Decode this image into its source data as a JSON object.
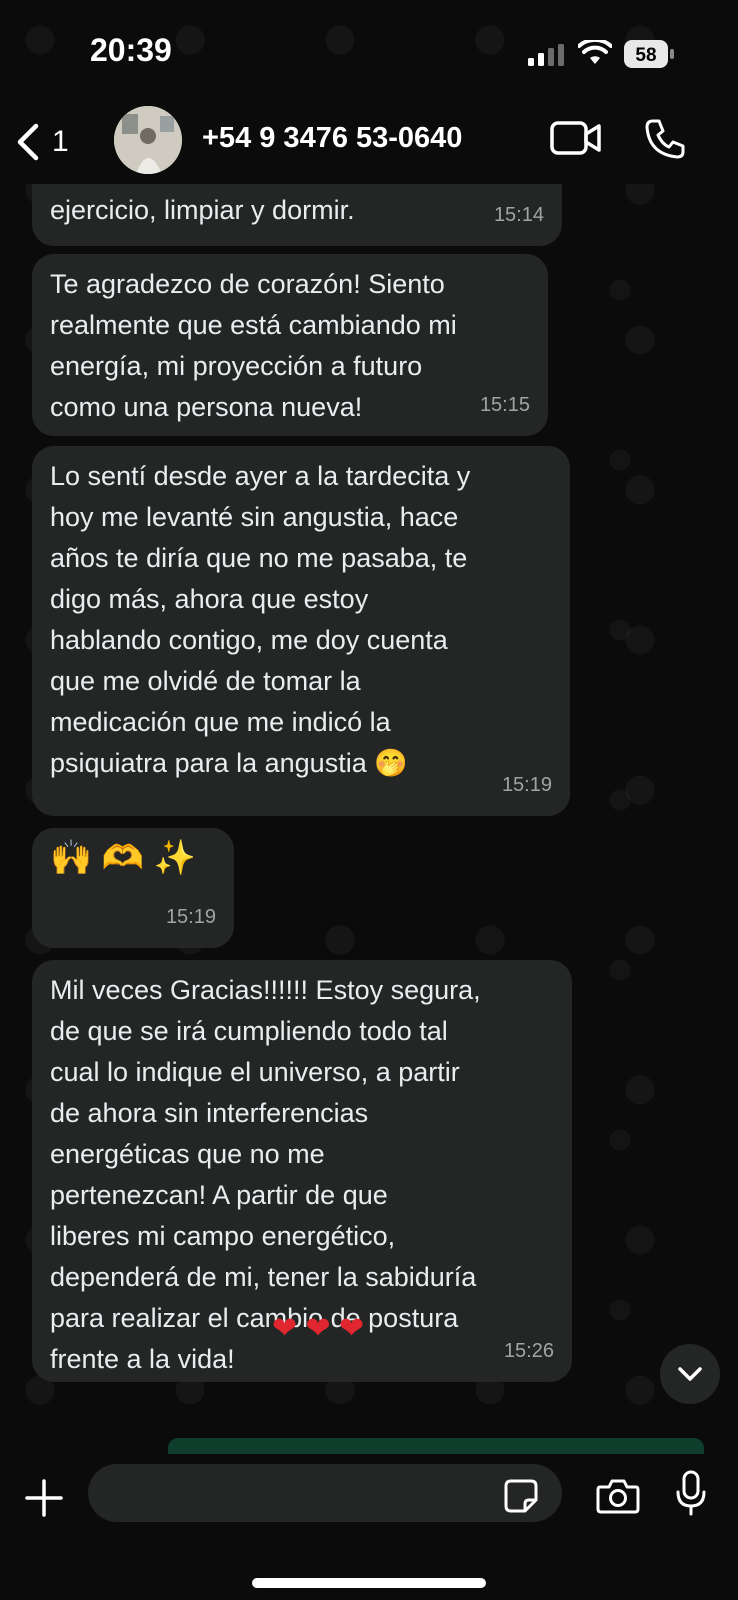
{
  "status": {
    "time": "20:39",
    "battery": "58"
  },
  "header": {
    "back_count": "1",
    "contact_name": "+54 9 3476 53-0640"
  },
  "messages": [
    {
      "text": "ejercicio, limpiar y dormir.",
      "time": "15:14"
    },
    {
      "text": "Te agradezco de corazón! Siento\nrealmente que está cambiando mi\nenergía, mi proyección a futuro\ncomo una persona nueva!",
      "time": "15:15"
    },
    {
      "text": "Lo sentí desde ayer a la tardecita y\nhoy me levanté sin angustia, hace\naños te diría que no me pasaba, te\ndigo más, ahora que estoy\nhablando contigo, me doy cuenta\nque me olvidé de tomar la\nmedicación que me indicó la\npsiquiatra para la angustia 🤭",
      "time": "15:19"
    },
    {
      "text": "🙌 🫶 ✨",
      "time": "15:19"
    },
    {
      "text": "Mil veces Gracias!!!!!! Estoy segura,\nde que se irá cumpliendo todo tal\ncual lo indique el universo, a partir\nde ahora sin interferencias\nenergéticas que no me\npertenezcan! A partir de que\nliberes mi campo energético,\ndependerá de mi, tener la sabiduría\npara realizar el cambio de postura\nfrente a la vida!",
      "hearts": "❤ ❤ ❤",
      "time": "15:26"
    }
  ],
  "composer": {
    "value": ""
  },
  "colors": {
    "bubble": "#242626",
    "background": "#0b0b0b",
    "accent_green": "#0f3d2c"
  },
  "icons": [
    "chevron-left-icon",
    "video-camera-icon",
    "phone-icon",
    "plus-icon",
    "sticker-icon",
    "camera-icon",
    "microphone-icon",
    "chevron-down-icon"
  ]
}
